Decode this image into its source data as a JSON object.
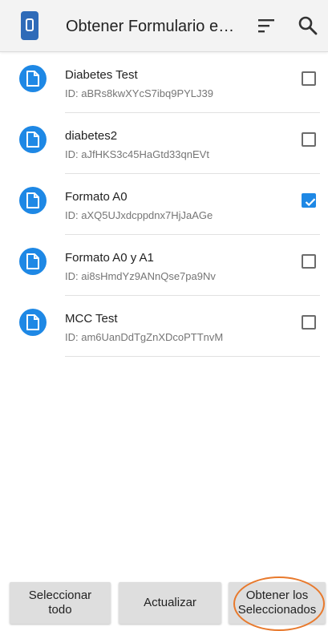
{
  "toolbar": {
    "title": "Obtener Formulario e…",
    "app_icon": "phone-icon",
    "sort_icon": "sort-icon",
    "search_icon": "search-icon"
  },
  "forms": [
    {
      "name": "Diabetes Test",
      "id": "ID: aBRs8kwXYcS7ibq9PYLJ39",
      "checked": false
    },
    {
      "name": "diabetes2",
      "id": "ID: aJfHKS3c45HaGtd33qnEVt",
      "checked": false
    },
    {
      "name": "Formato A0",
      "id": "ID: aXQ5UJxdcppdnx7HjJaAGe",
      "checked": true
    },
    {
      "name": "Formato A0 y A1",
      "id": "ID: ai8sHmdYz9ANnQse7pa9Nv",
      "checked": false
    },
    {
      "name": "MCC Test",
      "id": "ID: am6UanDdTgZnXDcoPTTnvM",
      "checked": false
    }
  ],
  "buttons": {
    "select_all": "Seleccionar\ntodo",
    "refresh": "Actualizar",
    "get_selected": "Obtener los\nSeleccionados"
  },
  "colors": {
    "accent": "#1e88e5",
    "app_icon": "#2f6bb8",
    "highlight": "#e8792c"
  }
}
